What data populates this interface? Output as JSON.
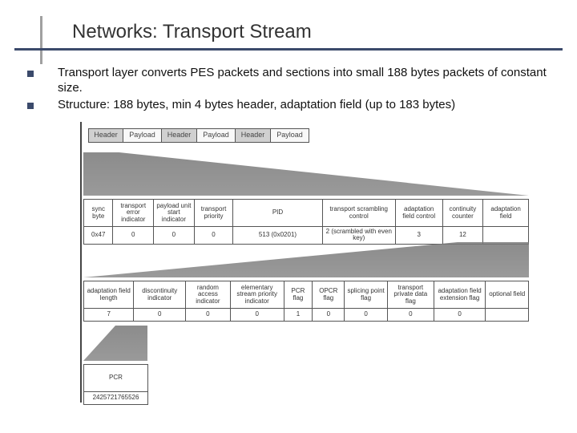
{
  "title": "Networks: Transport Stream",
  "bullets": [
    "Transport layer converts PES packets and sections into small 188 bytes packets of constant size.",
    "Structure: 188 bytes, min 4 bytes header, adaptation field (up to 183 bytes)"
  ],
  "packets": {
    "header": "Header",
    "payload": "Payload"
  },
  "header_fields": {
    "labels": [
      "sync byte",
      "transport error indicator",
      "payload unit start indicator",
      "transport priority",
      "PID",
      "transport scrambling control",
      "adaptation field control",
      "continuity counter",
      "adaptation field"
    ],
    "values": [
      "0x47",
      "0",
      "0",
      "0",
      "513 (0x0201)",
      "2 (scrambled with even key)",
      "3",
      "12",
      ""
    ]
  },
  "adaptation_fields": {
    "labels": [
      "adaptation field length",
      "discontinuity indicator",
      "random access indicator",
      "elementary stream priority indicator",
      "PCR flag",
      "OPCR flag",
      "splicing point flag",
      "transport private data flag",
      "adaptation field extension flag",
      "optional field"
    ],
    "values": [
      "7",
      "0",
      "0",
      "0",
      "1",
      "0",
      "0",
      "0",
      "0",
      ""
    ]
  },
  "pcr": {
    "label": "PCR",
    "value": "2425721765526"
  }
}
